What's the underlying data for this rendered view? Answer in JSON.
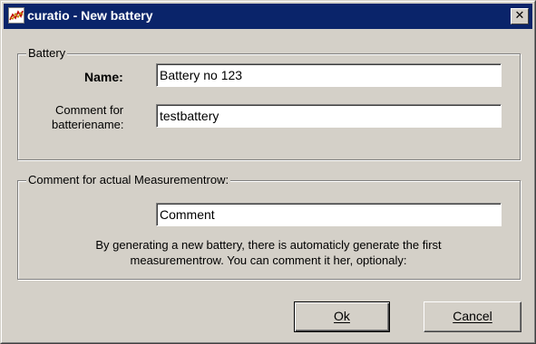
{
  "window": {
    "title": "curatio - New battery",
    "app_icon": "curatio-chart-icon",
    "close_glyph": "✕",
    "colors": {
      "titlebar": "#0a246a",
      "face": "#d4d0c8"
    }
  },
  "battery_group": {
    "legend": "Battery",
    "name_label": "Name:",
    "name_value": "Battery no 123",
    "comment_label_line1": "Comment for",
    "comment_label_line2": "batteriename:",
    "comment_value": "testbattery"
  },
  "measurement_group": {
    "legend": "Comment for actual Measurementrow:",
    "comment_value": "Comment",
    "info_line1": "By generating a new battery, there is automaticly generate the first",
    "info_line2": "measurementrow. You can comment it her, optionaly:"
  },
  "buttons": {
    "ok_label": "Ok",
    "cancel_label": "Cancel"
  }
}
